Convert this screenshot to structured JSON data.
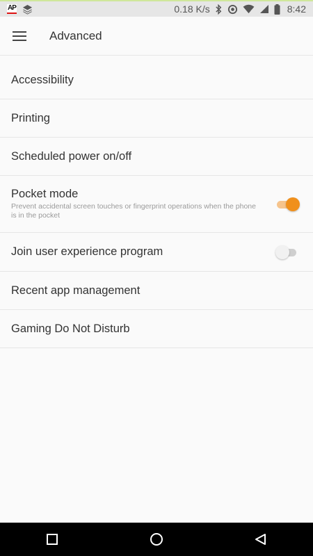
{
  "status_bar": {
    "app_badge": "AP",
    "net_speed": "0.18 K/s",
    "time": "8:42",
    "icons": [
      "ap-news-icon",
      "layers-icon",
      "bluetooth-icon",
      "data-saver-icon",
      "wifi-icon",
      "signal-icon",
      "battery-icon"
    ]
  },
  "app_bar": {
    "title": "Advanced",
    "menu_icon": "hamburger-menu-icon"
  },
  "settings": {
    "items": [
      {
        "label": "Accessibility"
      },
      {
        "label": "Printing"
      },
      {
        "label": "Scheduled power on/off"
      },
      {
        "label": "Pocket mode",
        "description": "Prevent accidental screen touches or fingerprint operations when the phone is in the pocket",
        "toggle": true,
        "enabled": true
      },
      {
        "label": "Join user experience program",
        "toggle": true,
        "enabled": false
      },
      {
        "label": "Recent app management"
      },
      {
        "label": "Gaming Do Not Disturb"
      }
    ]
  },
  "nav_bar": {
    "buttons": [
      "recents-square-icon",
      "home-circle-icon",
      "back-triangle-icon"
    ]
  },
  "colors": {
    "accent": "#f0901c",
    "accent_track": "#f6c48c",
    "background": "#fafafa",
    "status_bar": "#e6e6e6",
    "divider": "#e6e6e6"
  }
}
